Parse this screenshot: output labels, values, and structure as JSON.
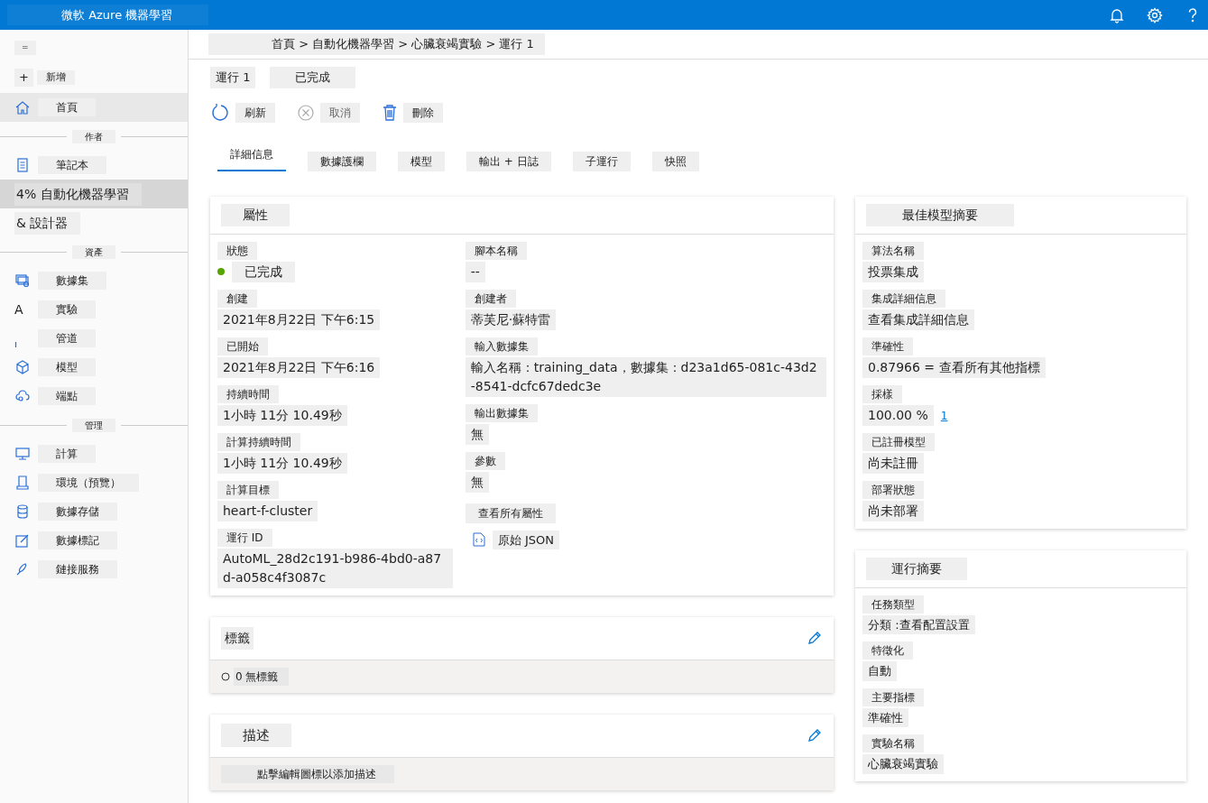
{
  "header": {
    "title": "微軟 Azure 機器學習"
  },
  "sidebar": {
    "menu": "=",
    "new_button": {
      "icon": "+",
      "label": "新增"
    },
    "items": [
      {
        "kind": "item",
        "label": "首頁",
        "selected": false,
        "hover": true
      },
      {
        "kind": "section",
        "label": "作者"
      },
      {
        "kind": "item",
        "label": "筆記本",
        "selected": false
      },
      {
        "kind": "plain",
        "label": "4% 自動化機器學習",
        "selected": true
      },
      {
        "kind": "plain",
        "label": "& 設計器",
        "selected": false
      },
      {
        "kind": "section",
        "label": "資產"
      },
      {
        "kind": "item",
        "label": "數據集",
        "selected": false
      },
      {
        "kind": "glyph",
        "glyph": "A",
        "label": "實驗",
        "selected": false
      },
      {
        "kind": "item",
        "label": "管道",
        "selected": false
      },
      {
        "kind": "item",
        "label": "模型",
        "selected": false
      },
      {
        "kind": "item",
        "label": "端點",
        "selected": false
      },
      {
        "kind": "section",
        "label": "管理"
      },
      {
        "kind": "item",
        "label": "計算",
        "selected": false
      },
      {
        "kind": "item",
        "label": "環境（預覽）",
        "selected": false
      },
      {
        "kind": "item",
        "label": "數據存儲",
        "selected": false
      },
      {
        "kind": "item",
        "label": "數據標記",
        "selected": false
      },
      {
        "kind": "item",
        "label": "鏈接服務",
        "selected": false
      }
    ]
  },
  "breadcrumb": "首頁 > 自動化機器學習 > 心臟衰竭實驗 > 運行 1",
  "run": {
    "title": "運行 1",
    "status": "已完成"
  },
  "toolbar": [
    {
      "label": "刷新",
      "disabled": false
    },
    {
      "label": "取消",
      "disabled": true
    },
    {
      "label": "刪除",
      "disabled": false
    }
  ],
  "tabs": [
    {
      "label": "詳細信息",
      "selected": true
    },
    {
      "label": "數據護欄",
      "selected": false
    },
    {
      "label": "模型",
      "selected": false
    },
    {
      "label": "輸出 + 日誌",
      "selected": false
    },
    {
      "label": "子運行",
      "selected": false
    },
    {
      "label": "快照",
      "selected": false
    }
  ],
  "properties": {
    "title": "屬性",
    "left": [
      {
        "label": "狀態",
        "value": "已完成",
        "kind": "status"
      },
      {
        "label": "創建",
        "value": "2021年8月22日 下午6:15"
      },
      {
        "label": "已開始",
        "value": "2021年8月22日 下午6:16"
      },
      {
        "label": "持續時間",
        "value": "1小時 11分 10.49秒"
      },
      {
        "label": "計算持續時間",
        "value": "1小時 11分 10.49秒"
      },
      {
        "label": "計算目標",
        "value": "heart-f-cluster"
      },
      {
        "label": "運行 ID",
        "value": "AutoML_28d2c191-b986-4bd0-a87d-a058c4f3087c"
      }
    ],
    "right": [
      {
        "label": "腳本名稱",
        "value": "--"
      },
      {
        "label": "創建者",
        "value": "蒂芙尼·蘇特雷"
      },
      {
        "label": "輸入數據集",
        "value": "輸入名稱：training_data，數據集：d23a1d65-081c-43d2-8541-dcfc67dedc3e"
      },
      {
        "label": "輸出數據集",
        "value": "無"
      },
      {
        "label": "參數",
        "value": "無"
      }
    ],
    "all_link": "查看所有屬性",
    "json_link": "原始 JSON"
  },
  "tags": {
    "title": "標籤",
    "body": "0 無標籤"
  },
  "description": {
    "title": "描述",
    "body": "點擊編輯圖標以添加描述"
  },
  "best_model": {
    "title": "最佳模型摘要",
    "fields": [
      {
        "label": "算法名稱",
        "value": "投票集成"
      },
      {
        "label": "集成詳細信息",
        "value": "查看集成詳細信息"
      },
      {
        "label": "準確性",
        "value": "0.87966 = 查看所有其他指標"
      },
      {
        "label": "採樣",
        "value": "100.00 %",
        "link": "1"
      },
      {
        "label": "已註冊模型",
        "value": "尚未註冊"
      },
      {
        "label": "部署狀態",
        "value": "尚未部署"
      }
    ]
  },
  "run_summary": {
    "title": "運行摘要",
    "fields": [
      {
        "label": "任務類型",
        "value": "分類 :查看配置設置"
      },
      {
        "label": "特徵化",
        "value": "自動"
      },
      {
        "label": "主要指標",
        "value": "準確性"
      },
      {
        "label": "實驗名稱",
        "value": "心臟衰竭實驗"
      }
    ]
  }
}
